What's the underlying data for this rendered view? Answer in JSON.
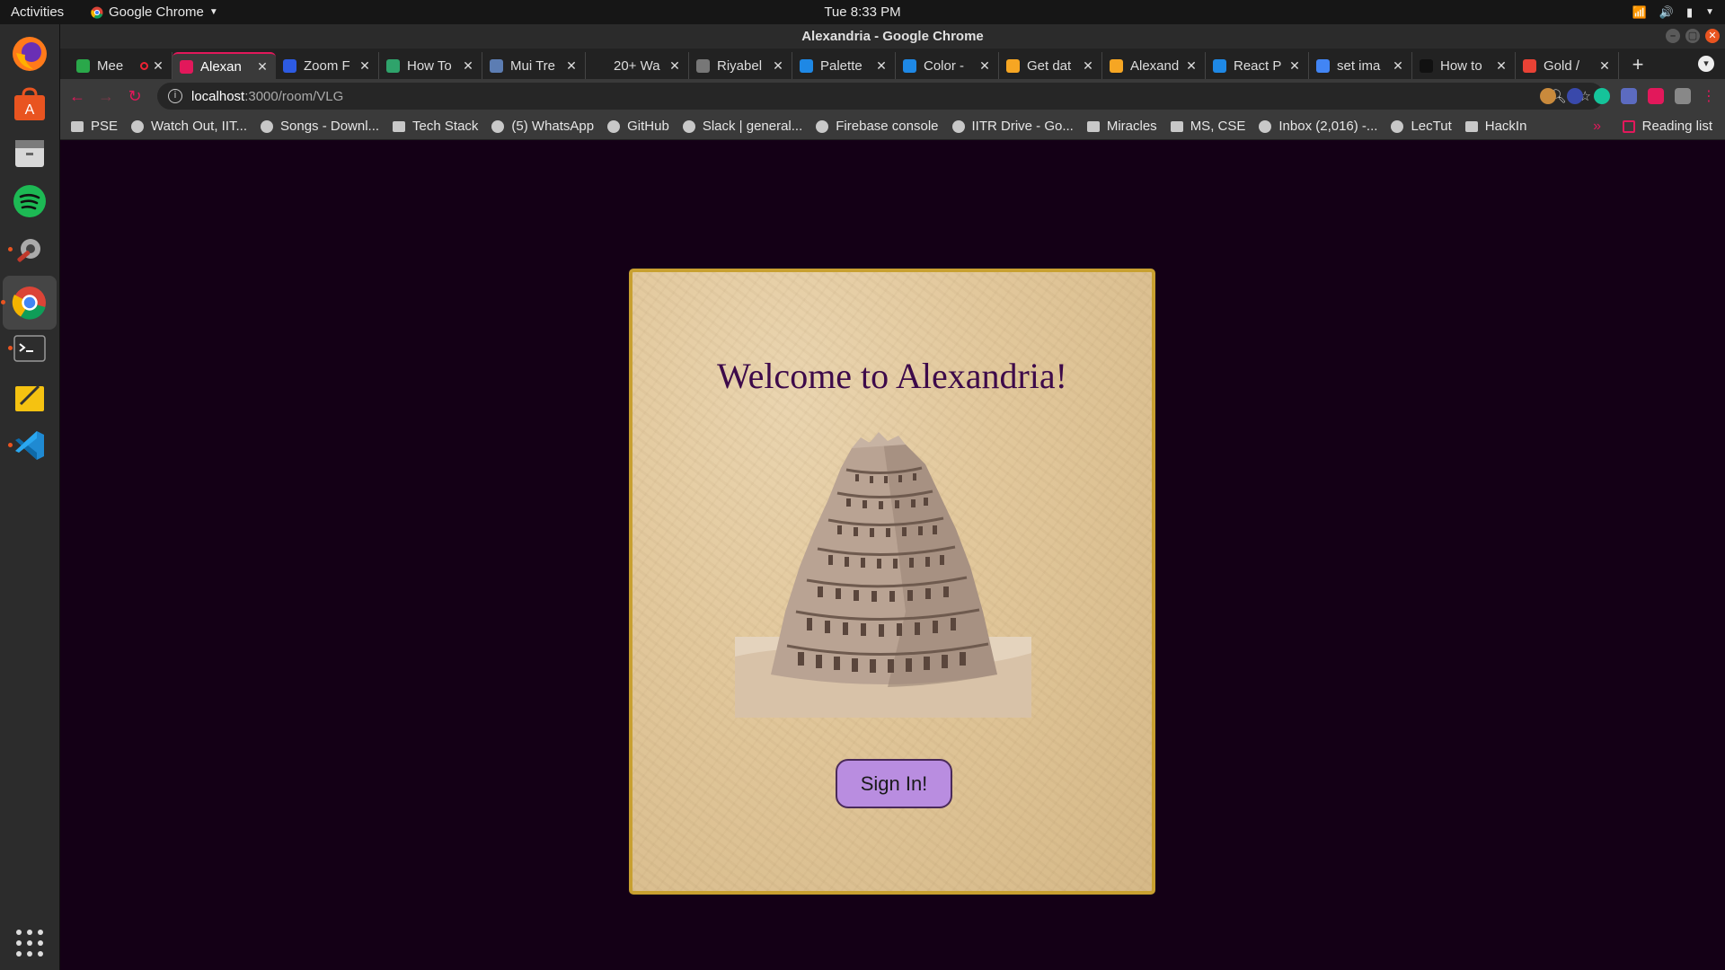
{
  "system": {
    "activities_label": "Activities",
    "app_menu_label": "Google Chrome",
    "clock": "Tue  8:33 PM"
  },
  "window": {
    "title": "Alexandria - Google Chrome"
  },
  "tabs": [
    {
      "title": "Mee",
      "favicon_color": "#2aa84a"
    },
    {
      "title": "Alexan",
      "favicon_color": "#e2185b"
    },
    {
      "title": "Zoom F",
      "favicon_color": "#2d5be3"
    },
    {
      "title": "How To",
      "favicon_color": "#2fa36b"
    },
    {
      "title": "Mui Tre",
      "favicon_color": "#5c7db3"
    },
    {
      "title": "20+ Wa",
      "favicon_color": "#222222"
    },
    {
      "title": "Riyabel",
      "favicon_color": "#777777"
    },
    {
      "title": "Palette",
      "favicon_color": "#1e88e5"
    },
    {
      "title": "Color - ",
      "favicon_color": "#1e88e5"
    },
    {
      "title": "Get dat",
      "favicon_color": "#f6a623"
    },
    {
      "title": "Alexand",
      "favicon_color": "#f6a623"
    },
    {
      "title": "React P",
      "favicon_color": "#1e88e5"
    },
    {
      "title": "set ima",
      "favicon_color": "#4285f4"
    },
    {
      "title": "How to",
      "favicon_color": "#111111"
    },
    {
      "title": "Gold / ",
      "favicon_color": "#e94235"
    }
  ],
  "address_bar": {
    "host": "localhost",
    "path": ":3000/room/VLG"
  },
  "bookmarks": [
    {
      "label": "PSE",
      "icon": "folder-icon"
    },
    {
      "label": "Watch Out, IIT...",
      "icon": "page-icon"
    },
    {
      "label": "Songs - Downl...",
      "icon": "page-icon"
    },
    {
      "label": "Tech Stack",
      "icon": "folder-icon"
    },
    {
      "label": "(5) WhatsApp",
      "icon": "whatsapp-icon"
    },
    {
      "label": "GitHub",
      "icon": "github-icon"
    },
    {
      "label": "Slack | general...",
      "icon": "slack-icon"
    },
    {
      "label": "Firebase console",
      "icon": "firebase-icon"
    },
    {
      "label": "IITR Drive - Go...",
      "icon": "drive-icon"
    },
    {
      "label": "Miracles",
      "icon": "folder-icon"
    },
    {
      "label": "MS, CSE",
      "icon": "folder-icon"
    },
    {
      "label": "Inbox (2,016) -...",
      "icon": "gmail-icon"
    },
    {
      "label": "LecTut",
      "icon": "page-icon"
    },
    {
      "label": "HackIn",
      "icon": "folder-icon"
    }
  ],
  "reading_list_label": "Reading list",
  "page": {
    "heading": "Welcome to Alexandria!",
    "signin_label": "Sign In!"
  }
}
